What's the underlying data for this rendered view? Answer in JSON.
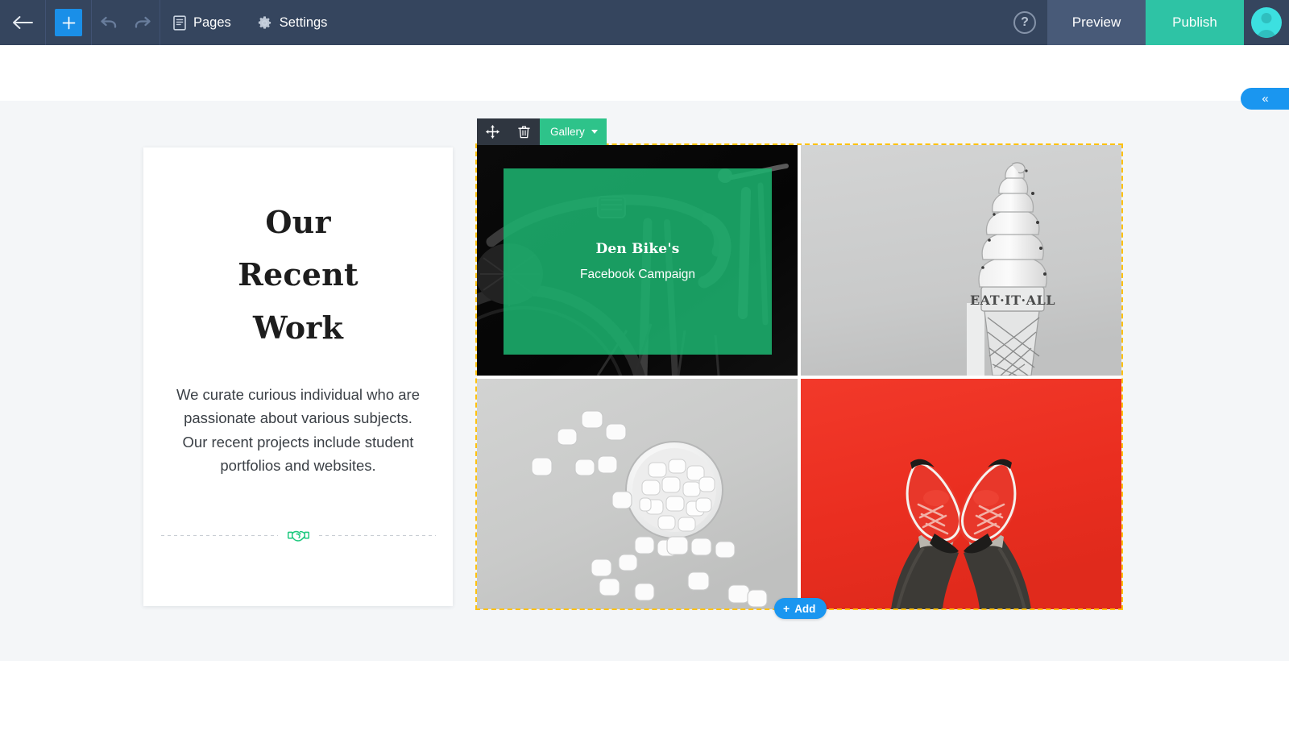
{
  "toolbar": {
    "back_icon": "arrow-left-icon",
    "add_block_icon": "plus-icon",
    "undo_icon": "undo-arrow-icon",
    "redo_icon": "redo-arrow-icon",
    "pages_label": "Pages",
    "pages_icon": "pages-document-icon",
    "settings_label": "Settings",
    "settings_icon": "gear-icon",
    "help_label": "?",
    "help_icon": "question-mark-circle-icon",
    "preview_label": "Preview",
    "publish_label": "Publish",
    "avatar_icon": "user-avatar-icon",
    "colors": {
      "bar": "#35455e",
      "add_block": "#1a8fe8",
      "preview": "#485a78",
      "publish": "#2ec3a5",
      "avatar": "#3ce0e0"
    }
  },
  "canvas": {
    "collapse_tab": {
      "label": "«",
      "icon": "chevron-double-left-icon",
      "color": "#1a96f0"
    },
    "text_card": {
      "title": "Our Recent Work",
      "body": "We curate curious individual who are passionate about various subjects. Our recent projects include student portfolios and websites.",
      "divider_icon": "handshake-icon",
      "divider_icon_color": "#1ec97f"
    },
    "gallery": {
      "toolbar": {
        "move_icon": "move-arrows-icon",
        "delete_icon": "trash-can-icon",
        "block_label": "Gallery",
        "caret_icon": "chevron-down-icon",
        "tag_color": "#2ec38a",
        "bar_color": "#2f3640"
      },
      "selection_color": "#ffc20e",
      "add_button": {
        "label": "Add",
        "plus": "+",
        "icon": "plus-icon",
        "color": "#1a96f0"
      },
      "items": [
        {
          "name": "bike-campaign-tile",
          "image_alt": "black and white bicycle handlebar close-up",
          "overlay_title": "Den Bike's",
          "overlay_subtitle": "Facebook Campaign",
          "overlay_color": "#1cb26e"
        },
        {
          "name": "ice-cream-tile",
          "image_alt": "grayscale soft-serve ice cream cone sign",
          "sign_text": "EAT·IT·ALL"
        },
        {
          "name": "marshmallows-tile",
          "image_alt": "white marshmallows spilling from a bowl on gray background"
        },
        {
          "name": "red-sneakers-tile",
          "image_alt": "red sneakers on red floor seen from above",
          "background_color": "#ef3124"
        }
      ]
    }
  }
}
